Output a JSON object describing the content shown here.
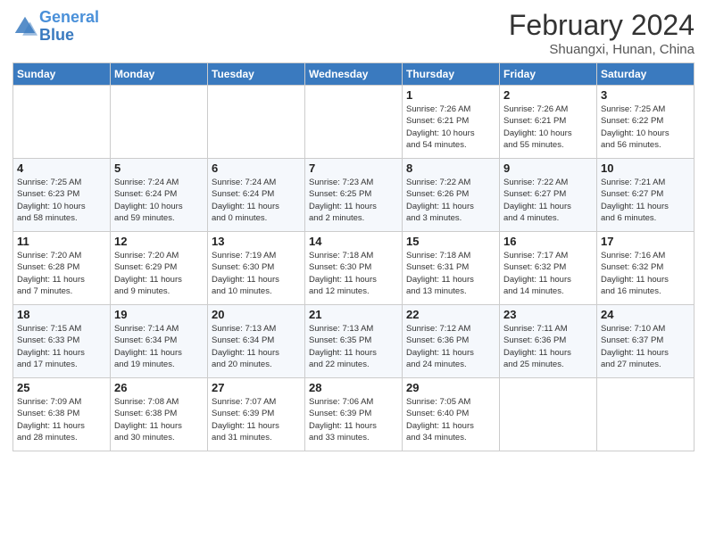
{
  "header": {
    "logo_general": "General",
    "logo_blue": "Blue",
    "month_year": "February 2024",
    "location": "Shuangxi, Hunan, China"
  },
  "days": [
    "Sunday",
    "Monday",
    "Tuesday",
    "Wednesday",
    "Thursday",
    "Friday",
    "Saturday"
  ],
  "weeks": [
    [
      {
        "date": "",
        "info": ""
      },
      {
        "date": "",
        "info": ""
      },
      {
        "date": "",
        "info": ""
      },
      {
        "date": "",
        "info": ""
      },
      {
        "date": "1",
        "info": "Sunrise: 7:26 AM\nSunset: 6:21 PM\nDaylight: 10 hours\nand 54 minutes."
      },
      {
        "date": "2",
        "info": "Sunrise: 7:26 AM\nSunset: 6:21 PM\nDaylight: 10 hours\nand 55 minutes."
      },
      {
        "date": "3",
        "info": "Sunrise: 7:25 AM\nSunset: 6:22 PM\nDaylight: 10 hours\nand 56 minutes."
      }
    ],
    [
      {
        "date": "4",
        "info": "Sunrise: 7:25 AM\nSunset: 6:23 PM\nDaylight: 10 hours\nand 58 minutes."
      },
      {
        "date": "5",
        "info": "Sunrise: 7:24 AM\nSunset: 6:24 PM\nDaylight: 10 hours\nand 59 minutes."
      },
      {
        "date": "6",
        "info": "Sunrise: 7:24 AM\nSunset: 6:24 PM\nDaylight: 11 hours\nand 0 minutes."
      },
      {
        "date": "7",
        "info": "Sunrise: 7:23 AM\nSunset: 6:25 PM\nDaylight: 11 hours\nand 2 minutes."
      },
      {
        "date": "8",
        "info": "Sunrise: 7:22 AM\nSunset: 6:26 PM\nDaylight: 11 hours\nand 3 minutes."
      },
      {
        "date": "9",
        "info": "Sunrise: 7:22 AM\nSunset: 6:27 PM\nDaylight: 11 hours\nand 4 minutes."
      },
      {
        "date": "10",
        "info": "Sunrise: 7:21 AM\nSunset: 6:27 PM\nDaylight: 11 hours\nand 6 minutes."
      }
    ],
    [
      {
        "date": "11",
        "info": "Sunrise: 7:20 AM\nSunset: 6:28 PM\nDaylight: 11 hours\nand 7 minutes."
      },
      {
        "date": "12",
        "info": "Sunrise: 7:20 AM\nSunset: 6:29 PM\nDaylight: 11 hours\nand 9 minutes."
      },
      {
        "date": "13",
        "info": "Sunrise: 7:19 AM\nSunset: 6:30 PM\nDaylight: 11 hours\nand 10 minutes."
      },
      {
        "date": "14",
        "info": "Sunrise: 7:18 AM\nSunset: 6:30 PM\nDaylight: 11 hours\nand 12 minutes."
      },
      {
        "date": "15",
        "info": "Sunrise: 7:18 AM\nSunset: 6:31 PM\nDaylight: 11 hours\nand 13 minutes."
      },
      {
        "date": "16",
        "info": "Sunrise: 7:17 AM\nSunset: 6:32 PM\nDaylight: 11 hours\nand 14 minutes."
      },
      {
        "date": "17",
        "info": "Sunrise: 7:16 AM\nSunset: 6:32 PM\nDaylight: 11 hours\nand 16 minutes."
      }
    ],
    [
      {
        "date": "18",
        "info": "Sunrise: 7:15 AM\nSunset: 6:33 PM\nDaylight: 11 hours\nand 17 minutes."
      },
      {
        "date": "19",
        "info": "Sunrise: 7:14 AM\nSunset: 6:34 PM\nDaylight: 11 hours\nand 19 minutes."
      },
      {
        "date": "20",
        "info": "Sunrise: 7:13 AM\nSunset: 6:34 PM\nDaylight: 11 hours\nand 20 minutes."
      },
      {
        "date": "21",
        "info": "Sunrise: 7:13 AM\nSunset: 6:35 PM\nDaylight: 11 hours\nand 22 minutes."
      },
      {
        "date": "22",
        "info": "Sunrise: 7:12 AM\nSunset: 6:36 PM\nDaylight: 11 hours\nand 24 minutes."
      },
      {
        "date": "23",
        "info": "Sunrise: 7:11 AM\nSunset: 6:36 PM\nDaylight: 11 hours\nand 25 minutes."
      },
      {
        "date": "24",
        "info": "Sunrise: 7:10 AM\nSunset: 6:37 PM\nDaylight: 11 hours\nand 27 minutes."
      }
    ],
    [
      {
        "date": "25",
        "info": "Sunrise: 7:09 AM\nSunset: 6:38 PM\nDaylight: 11 hours\nand 28 minutes."
      },
      {
        "date": "26",
        "info": "Sunrise: 7:08 AM\nSunset: 6:38 PM\nDaylight: 11 hours\nand 30 minutes."
      },
      {
        "date": "27",
        "info": "Sunrise: 7:07 AM\nSunset: 6:39 PM\nDaylight: 11 hours\nand 31 minutes."
      },
      {
        "date": "28",
        "info": "Sunrise: 7:06 AM\nSunset: 6:39 PM\nDaylight: 11 hours\nand 33 minutes."
      },
      {
        "date": "29",
        "info": "Sunrise: 7:05 AM\nSunset: 6:40 PM\nDaylight: 11 hours\nand 34 minutes."
      },
      {
        "date": "",
        "info": ""
      },
      {
        "date": "",
        "info": ""
      }
    ]
  ]
}
